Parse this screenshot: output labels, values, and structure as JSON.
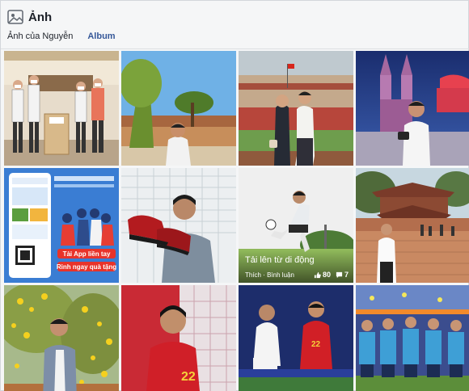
{
  "header": {
    "title": "Ảnh",
    "icon": "photos-icon"
  },
  "tabs": [
    {
      "label": "Ảnh của Nguyễn"
    },
    {
      "label": "Album"
    }
  ],
  "tiles": [
    {
      "id": "photo-1",
      "text": []
    },
    {
      "id": "photo-2",
      "text": []
    },
    {
      "id": "photo-3",
      "text": []
    },
    {
      "id": "photo-4",
      "text": []
    },
    {
      "id": "photo-5",
      "text": [
        "Tải App liền tay",
        "Rinh ngay quà tặng"
      ]
    },
    {
      "id": "photo-6",
      "text": []
    },
    {
      "id": "photo-7",
      "text": []
    },
    {
      "id": "photo-8",
      "text": []
    },
    {
      "id": "photo-9",
      "text": []
    },
    {
      "id": "photo-10",
      "text": [
        "22"
      ]
    },
    {
      "id": "photo-11",
      "text": [
        "22"
      ]
    },
    {
      "id": "photo-12",
      "text": []
    }
  ],
  "hover_tile": {
    "upload_text": "Tải lên từ di động",
    "actions": "Thích · Bình luận",
    "likes": "80",
    "comments": "7"
  },
  "colors": {
    "link": "#365899",
    "accent": "#4267b2"
  }
}
